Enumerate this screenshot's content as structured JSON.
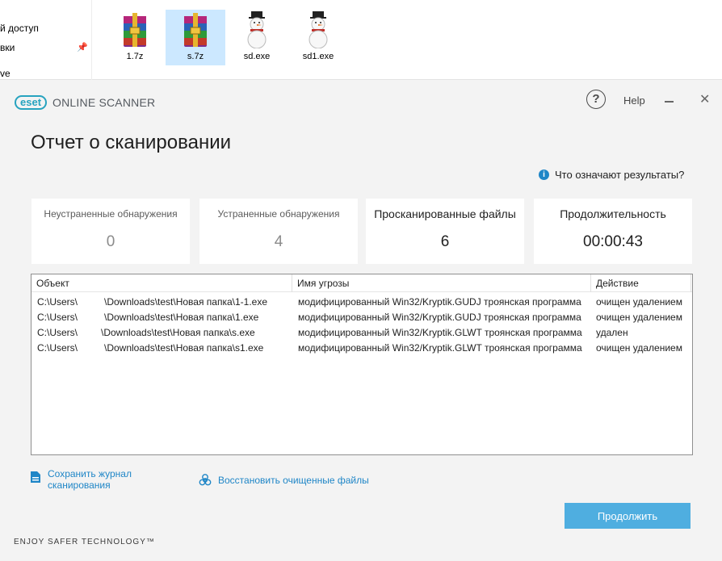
{
  "explorer": {
    "nav_items": [
      "й доступ",
      "вки",
      "ve"
    ],
    "files": [
      {
        "name": "1.7z",
        "icon": "winrar-archive-icon",
        "selected": false
      },
      {
        "name": "s.7z",
        "icon": "winrar-archive-icon",
        "selected": true
      },
      {
        "name": "sd.exe",
        "icon": "snowman-icon",
        "selected": false
      },
      {
        "name": "sd1.exe",
        "icon": "snowman-icon",
        "selected": false
      }
    ]
  },
  "window": {
    "logo_brand": "eset",
    "logo_product": "ONLINE SCANNER",
    "help_label": "Help",
    "title": "Отчет о сканировании",
    "info_link": "Что означают результаты?",
    "accent_color": "#27a3bf",
    "link_color": "#1f86c7",
    "button_color": "#4faee0"
  },
  "summary": [
    {
      "label": "Неустраненные обнаружения",
      "value": "0"
    },
    {
      "label": "Устраненные обнаружения",
      "value": "4"
    },
    {
      "label": "Просканированные файлы",
      "value": "6"
    },
    {
      "label": "Продолжительность",
      "value": "00:00:43"
    }
  ],
  "table": {
    "columns": [
      "Объект",
      "Имя угрозы",
      "Действие"
    ],
    "rows": [
      {
        "object_a": "C:\\Users\\",
        "object_b": "\\Downloads\\test\\Новая папка\\1-1.exe",
        "threat": "модифицированный Win32/Kryptik.GUDJ троянская программа",
        "action": "очищен удалением"
      },
      {
        "object_a": "C:\\Users\\",
        "object_b": "\\Downloads\\test\\Новая папка\\1.exe",
        "threat": "модифицированный Win32/Kryptik.GUDJ троянская программа",
        "action": "очищен удалением"
      },
      {
        "object_a": "C:\\Users\\",
        "object_b": "\\Downloads\\test\\Новая папка\\s.exe",
        "threat": "модифицированный Win32/Kryptik.GLWT троянская программа",
        "action": "удален"
      },
      {
        "object_a": "C:\\Users\\",
        "object_b": "\\Downloads\\test\\Новая папка\\s1.exe",
        "threat": "модифицированный Win32/Kryptik.GLWT троянская программа",
        "action": "очищен удалением"
      }
    ]
  },
  "actions": {
    "save_log_line1": "Сохранить журнал",
    "save_log_line2": "сканирования",
    "restore": "Восстановить очищенные файлы",
    "continue": "Продолжить"
  },
  "footer": "ENJOY SAFER TECHNOLOGY™"
}
